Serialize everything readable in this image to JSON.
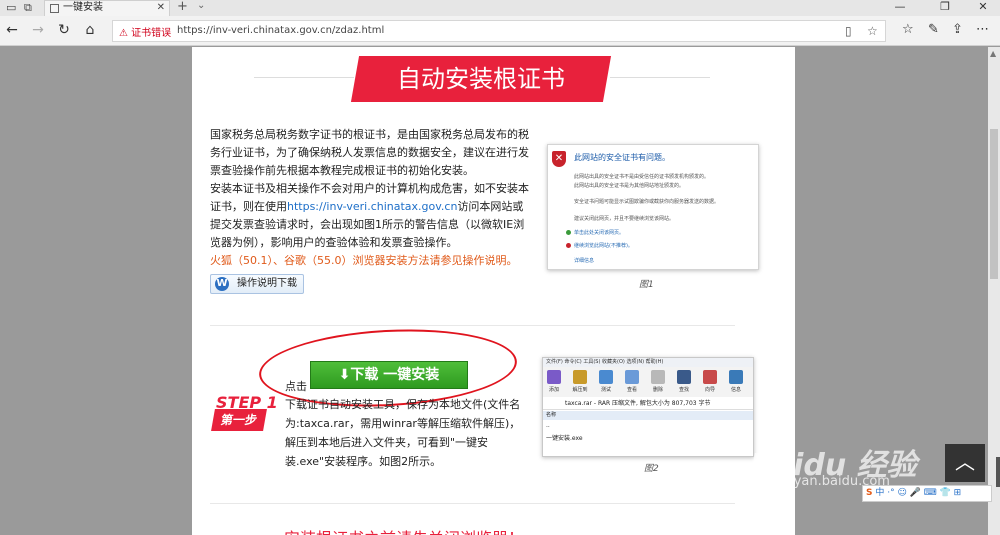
{
  "browser": {
    "tab_title": "一键安装",
    "cert_warning": "证书错误",
    "url": "https://inv-veri.chinatax.gov.cn/zdaz.html",
    "new_tab": "+",
    "close": "✕"
  },
  "page": {
    "banner_title": "自动安装根证书",
    "para1_a": "国家税务总局税务数字证书的根证书，是由国家税务总局发布的税务行业证书，为了确保纳税人发票信息的数据安全，建议在进行发票查验操作前先根据本教程完成根证书的初始化安装。",
    "para1_b": "安装本证书及相关操作不会对用户的计算机构成危害，如不安装本证书，则在使用",
    "para1_link": "https://inv-veri.chinatax.gov.cn",
    "para1_c": "访问本网站或提交发票查验请求时，会出现如图1所示的警告信息（以微软IE浏览器为例），影响用户的查验体验和发票查验操作。",
    "para1_red": "火狐（50.1）、谷歌（55.0）浏览器安装方法请参见操作说明。",
    "manual_button": "操作说明下载",
    "fig1_title": "此网站的安全证书有问题。",
    "fig1_lines": [
      "此网站出具的安全证书不是由受信任的证书颁发机构颁发的。",
      "此网站出具的安全证书是为其他网站地址颁发的。",
      "安全证书问题可能显示试图欺骗你或截获你向服务器发送的数据。",
      "建议关闭此网页，并且不要继续浏览该网站。"
    ],
    "fig1_link1": "单击此处关闭该网页。",
    "fig1_link2": "继续浏览此网站(不推荐)。",
    "fig1_more": "详细信息",
    "fig1_caption": "图1",
    "step_en": "STEP 1",
    "step_cn": "第一步",
    "click_label": "点击",
    "download_button": "⬇下载 一键安装",
    "para2": "下载证书自动安装工具，保存为本地文件(文件名为:taxca.rar，需用winrar等解压缩软件解压)，解压到本地后进入文件夹，可看到\"一键安装.exe\"安装程序。如图2所示。",
    "fig2_menu": "文件(F) 命令(C) 工具(S) 收藏夹(O) 选项(N) 帮助(H)",
    "fig2_tools": [
      "添加",
      "解压到",
      "测试",
      "查看",
      "删除",
      "查找",
      "向导",
      "信息"
    ],
    "fig2_path": "taxca.rar - RAR 压缩文件, 解包大小为 807,703 字节",
    "fig2_header": "名称",
    "fig2_rows": [
      "..",
      "一键安装.exe"
    ],
    "fig2_caption": "图2",
    "bottom_text": "安装根证书之前请先关闭浏览器！"
  },
  "overlay": {
    "watermark": "Baidu 经验",
    "watermark_url": "jingyan.baidu.com",
    "ime_text": "中 ·° ☺ 🎤 ⌨ 👕 ⊞",
    "ime_s": "S"
  }
}
